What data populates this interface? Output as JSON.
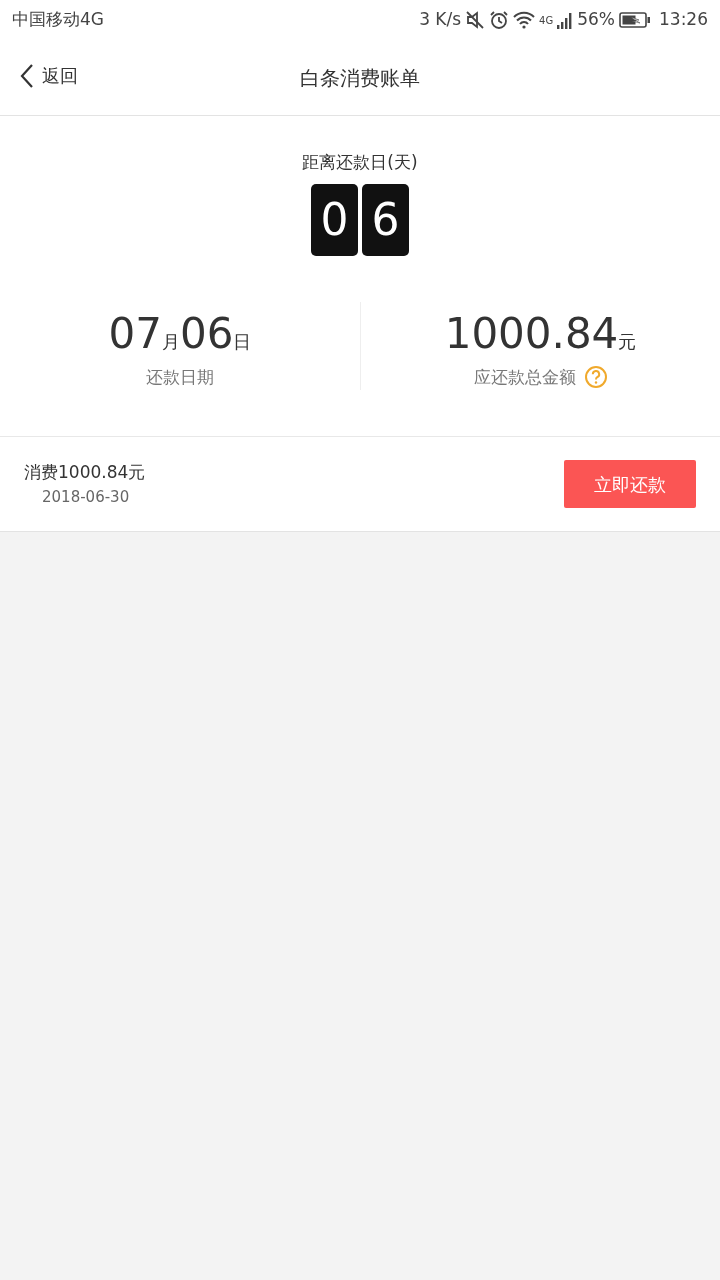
{
  "status_bar": {
    "carrier": "中国移动4G",
    "speed": "3 K/s",
    "network": "4G",
    "battery": "56%",
    "time": "13:26"
  },
  "nav": {
    "back": "返回",
    "title": "白条消费账单"
  },
  "countdown": {
    "label": "距离还款日(天)",
    "digits": [
      "0",
      "6"
    ]
  },
  "summary": {
    "month": "07",
    "month_unit": "月",
    "day": "06",
    "day_unit": "日",
    "date_label": "还款日期",
    "amount": "1000.84",
    "amount_unit": "元",
    "amount_label": "应还款总金额"
  },
  "bills": [
    {
      "title": "消费1000.84元",
      "date": "2018-06-30",
      "button": "立即还款"
    }
  ]
}
